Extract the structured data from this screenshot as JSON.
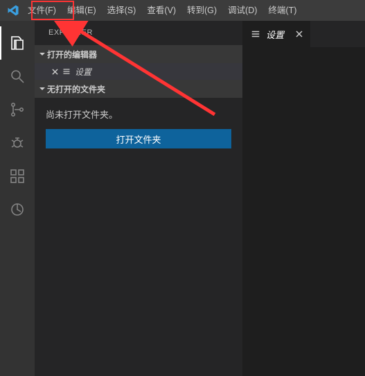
{
  "menubar": {
    "items": [
      {
        "label": "文件(F)"
      },
      {
        "label": "编辑(E)"
      },
      {
        "label": "选择(S)"
      },
      {
        "label": "查看(V)"
      },
      {
        "label": "转到(G)"
      },
      {
        "label": "调试(D)"
      },
      {
        "label": "终端(T)"
      }
    ]
  },
  "sidebar": {
    "title": "EXPLORER",
    "sections": {
      "openEditors": {
        "label": "打开的编辑器"
      },
      "settingsTab": {
        "label": "设置"
      },
      "noFolder": {
        "label": "无打开的文件夹"
      }
    },
    "body": {
      "message": "尚未打开文件夹。",
      "openButton": "打开文件夹"
    }
  },
  "editor": {
    "tab": {
      "label": "设置"
    }
  }
}
